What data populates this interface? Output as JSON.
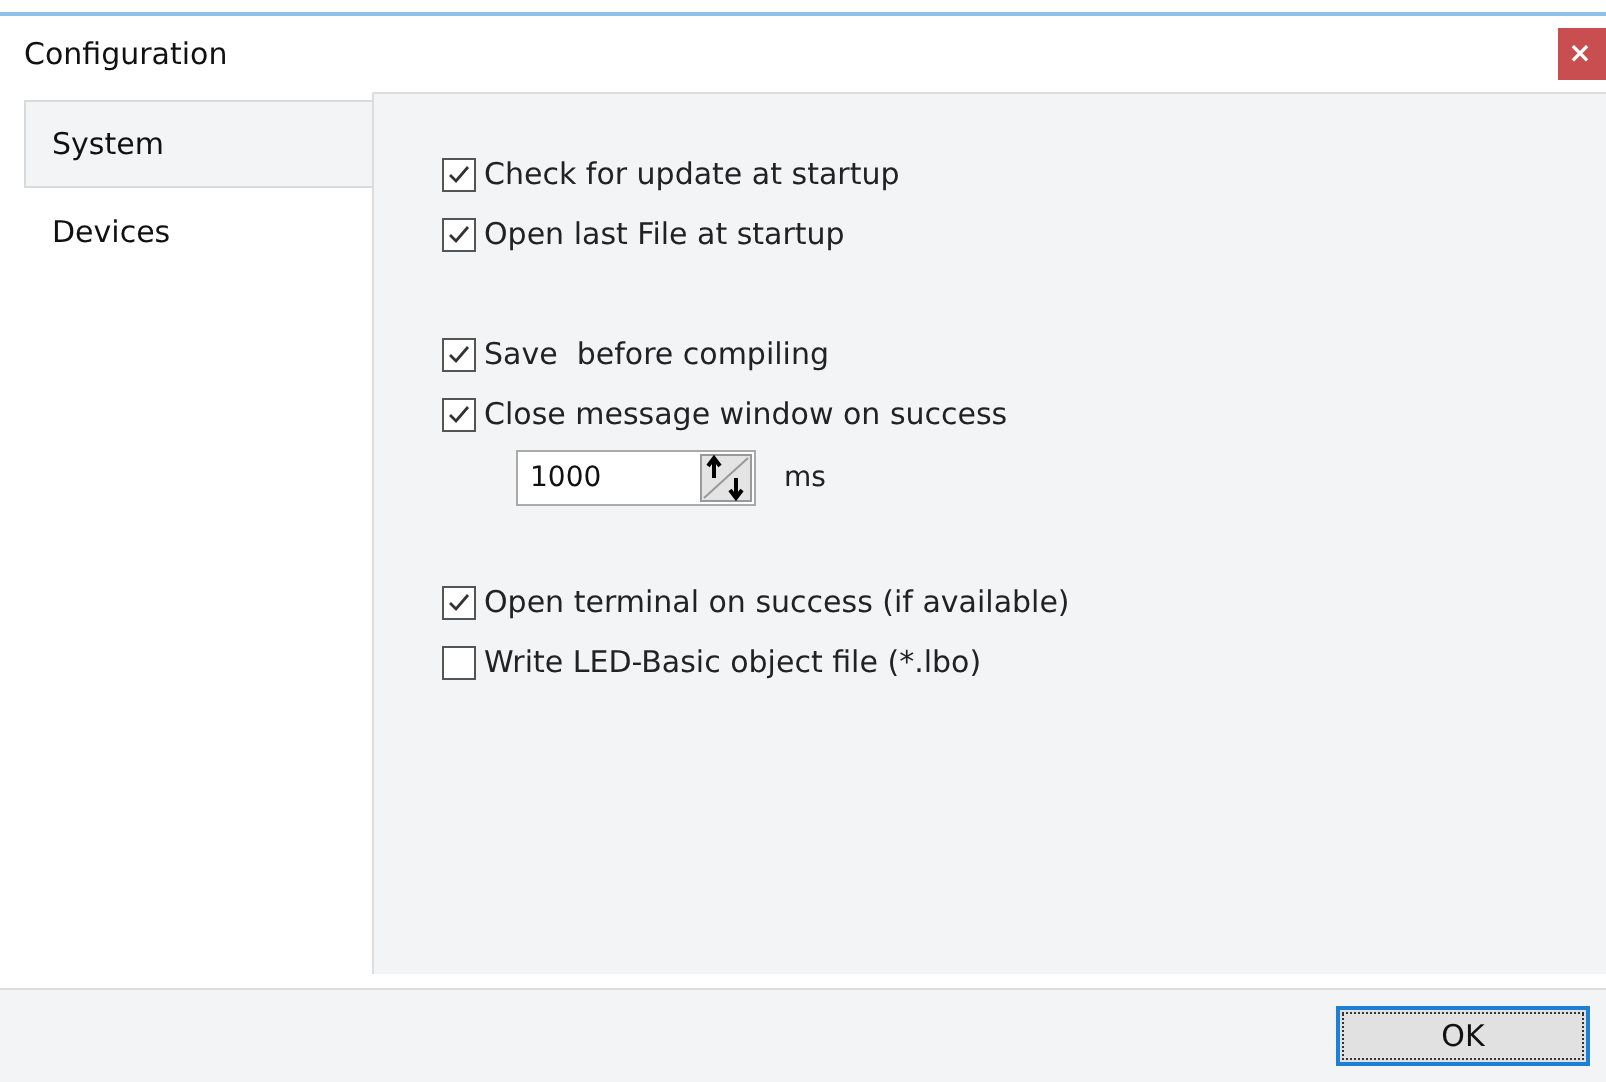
{
  "window": {
    "title": "Configuration",
    "close": "×"
  },
  "tabs": [
    {
      "label": "System",
      "selected": true
    },
    {
      "label": "Devices",
      "selected": false
    }
  ],
  "groups": [
    [
      {
        "kind": "checkbox",
        "label": "Check for update at startup",
        "checked": true
      },
      {
        "kind": "checkbox",
        "label": "Open last File at startup",
        "checked": true
      }
    ],
    [
      {
        "kind": "checkbox",
        "label": "Save  before compiling",
        "checked": true
      },
      {
        "kind": "checkbox",
        "label": "Close message window on success",
        "checked": true
      },
      {
        "kind": "spinner",
        "value": "1000",
        "unit": "ms"
      }
    ],
    [
      {
        "kind": "checkbox",
        "label": "Open terminal on success (if available)",
        "checked": true
      },
      {
        "kind": "checkbox",
        "label": "Write LED-Basic object file (*.lbo)",
        "checked": false
      }
    ]
  ],
  "buttons": [
    "OK"
  ]
}
